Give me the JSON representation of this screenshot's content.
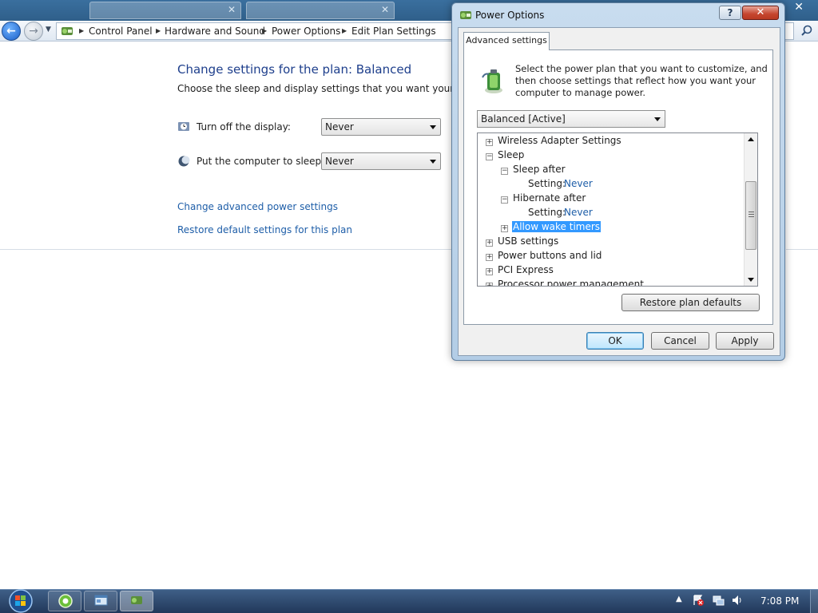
{
  "address_bar": {
    "crumbs": [
      "Control Panel",
      "Hardware and Sound",
      "Power Options",
      "Edit Plan Settings"
    ]
  },
  "main": {
    "title": "Change settings for the plan: Balanced",
    "description": "Choose the sleep and display settings that you want your comput",
    "display_label": "Turn off the display:",
    "display_value": "Never",
    "sleep_label": "Put the computer to sleep:",
    "sleep_value": "Never",
    "advanced_link": "Change advanced power settings",
    "restore_link": "Restore default settings for this plan"
  },
  "dialog": {
    "title": "Power Options",
    "help": "?",
    "close": "✕",
    "tab": "Advanced settings",
    "intro_lines": [
      "Select the power plan that you want to customize, and",
      "then choose settings that reflect how you want your",
      "computer to manage power."
    ],
    "plan_select": "Balanced [Active]",
    "tree": {
      "wireless": "Wireless Adapter Settings",
      "sleep": "Sleep",
      "sleep_after": "Sleep after",
      "setting_label": "Setting:",
      "sleep_after_value": "Never",
      "hibernate_after": "Hibernate after",
      "hibernate_after_value": "Never",
      "wake_timers": "Allow wake timers",
      "usb": "USB settings",
      "power_buttons": "Power buttons and lid",
      "pci": "PCI Express",
      "processor": "Processor power management"
    },
    "restore_btn": "Restore plan defaults",
    "ok_btn": "OK",
    "cancel_btn": "Cancel",
    "apply_btn": "Apply"
  },
  "taskbar": {
    "clock": "7:08 PM"
  },
  "colors": {
    "link": "#1e5ea8",
    "title_blue": "#1e3f8c",
    "selection": "#3399ff"
  }
}
